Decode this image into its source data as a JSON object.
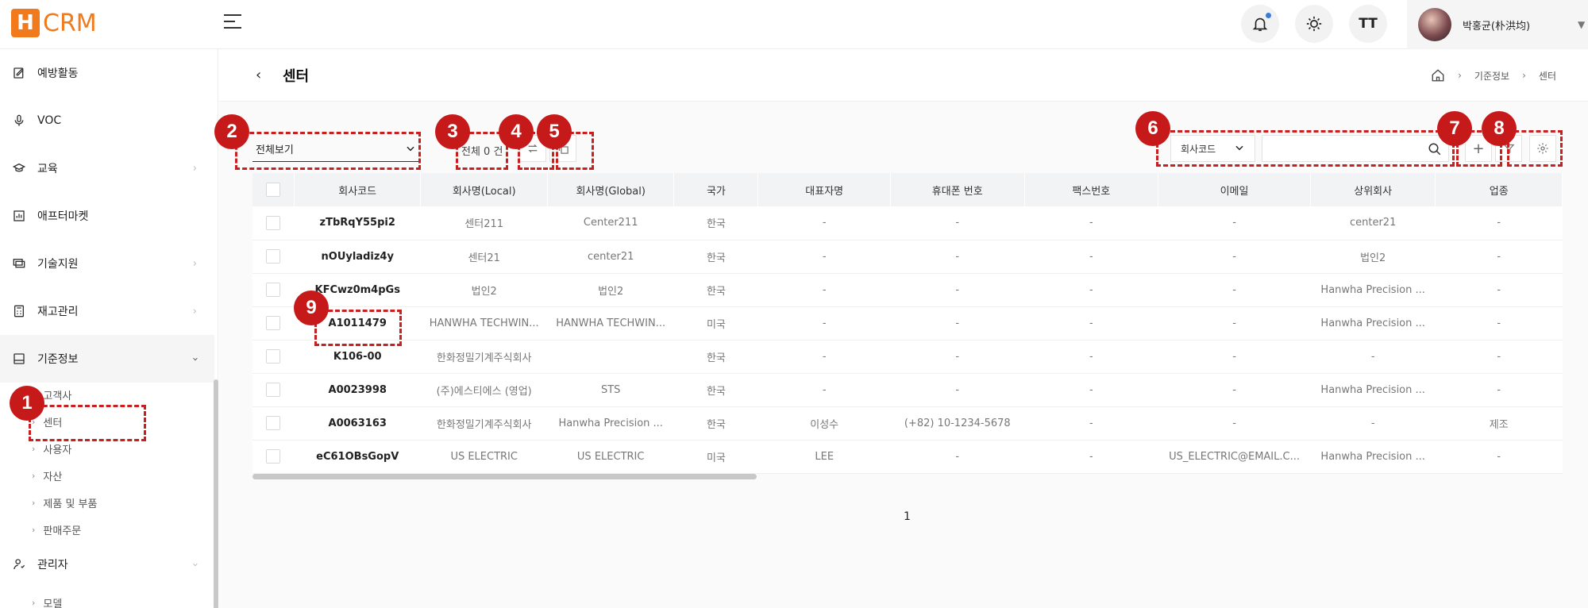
{
  "app": {
    "logo_letter": "H",
    "logo_text": "CRM"
  },
  "topbar": {
    "user_name": "박홍균(朴洪均)",
    "text_size_label": "TT"
  },
  "sidebar": {
    "items": [
      {
        "label": "예방활동",
        "icon": "edit-icon",
        "has_chevron": false
      },
      {
        "label": "VOC",
        "icon": "microphone-icon",
        "has_chevron": false
      },
      {
        "label": "교육",
        "icon": "graduation-cap-icon",
        "has_chevron": true
      },
      {
        "label": "애프터마켓",
        "icon": "chart-icon",
        "has_chevron": false
      },
      {
        "label": "기술지원",
        "icon": "monitor-icon",
        "has_chevron": true
      },
      {
        "label": "재고관리",
        "icon": "calculator-icon",
        "has_chevron": true
      },
      {
        "label": "기준정보",
        "icon": "database-icon",
        "has_chevron": true
      },
      {
        "label": "관리자",
        "icon": "user-settings-icon",
        "has_chevron": true
      }
    ],
    "sub_items": [
      "고객사",
      "센터",
      "사용자",
      "자산",
      "제품 및 부품",
      "판매주문"
    ],
    "admin_sub_items": [
      "모델"
    ]
  },
  "page": {
    "title": "센터",
    "breadcrumb": [
      "기준정보",
      "센터"
    ]
  },
  "toolbar": {
    "view_select": "전체보기",
    "count_label": "전체 0 건",
    "search_type": "회사코드",
    "search_value": ""
  },
  "table": {
    "columns": [
      "회사코드",
      "회사명(Local)",
      "회사명(Global)",
      "국가",
      "대표자명",
      "휴대폰 번호",
      "팩스번호",
      "이메일",
      "상위회사",
      "업종"
    ],
    "rows": [
      [
        "zTbRqY55pi2",
        "센터211",
        "Center211",
        "한국",
        "-",
        "-",
        "-",
        "-",
        "center21",
        "-"
      ],
      [
        "nOUyladiz4y",
        "센터21",
        "center21",
        "한국",
        "-",
        "-",
        "-",
        "-",
        "법인2",
        "-"
      ],
      [
        "KFCwz0m4pGs",
        "법인2",
        "법인2",
        "한국",
        "-",
        "-",
        "-",
        "-",
        "Hanwha Precision ...",
        "-"
      ],
      [
        "A1011479",
        "HANWHA TECHWIN...",
        "HANWHA TECHWIN...",
        "미국",
        "-",
        "-",
        "-",
        "-",
        "Hanwha Precision ...",
        "-"
      ],
      [
        "K106-00",
        "한화정밀기계주식회사",
        "",
        "한국",
        "-",
        "-",
        "-",
        "-",
        "-",
        "-"
      ],
      [
        "A0023998",
        "(주)에스티에스 (영업)",
        "STS",
        "한국",
        "-",
        "-",
        "-",
        "-",
        "Hanwha Precision ...",
        "-"
      ],
      [
        "A0063163",
        "한화정밀기계주식회사",
        "Hanwha Precision ...",
        "한국",
        "이성수",
        "(+82) 10-1234-5678",
        "-",
        "-",
        "-",
        "제조"
      ],
      [
        "eC61OBsGopV",
        "US ELECTRIC",
        "US ELECTRIC",
        "미국",
        "LEE",
        "-",
        "-",
        "US_ELECTRIC@EMAIL.C...",
        "Hanwha Precision ...",
        "-"
      ]
    ]
  },
  "pagination": {
    "current": "1"
  },
  "annotations": [
    "1",
    "2",
    "3",
    "4",
    "5",
    "6",
    "7",
    "8",
    "9"
  ],
  "colors": {
    "brand": "#f07a1c",
    "annotation": "#c61a1a"
  }
}
